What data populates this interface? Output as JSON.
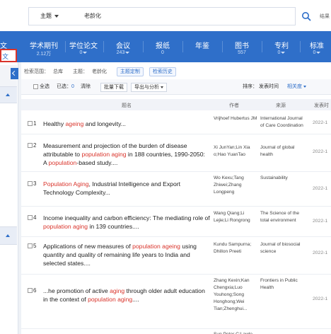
{
  "topbar": {
    "subject_label": "主题",
    "search_value": "老龄化",
    "right_text": "结果"
  },
  "nav": {
    "left_partial": "文",
    "items": [
      {
        "label": "学术期刊",
        "count": "2.12万"
      },
      {
        "label": "学位论文",
        "count": "0"
      },
      {
        "label": "会议",
        "count": "243"
      },
      {
        "label": "报纸",
        "count": "0"
      },
      {
        "label": "年鉴",
        "count": ""
      },
      {
        "label": "图书",
        "count": "557"
      },
      {
        "label": "专利",
        "count": "0"
      },
      {
        "label": "标准",
        "count": "0"
      }
    ]
  },
  "left_panel": {
    "selected_label": "文"
  },
  "filters": {
    "scope_label": "检索范围：",
    "scope_value": "总库",
    "subject_label": "主题：",
    "subject_value": "老龄化",
    "tag1": "主题定制",
    "tag2": "检索历史"
  },
  "toolbar": {
    "select_all": "全选",
    "selected": "已选：",
    "selected_count": "0",
    "clear": "清除",
    "batch_download": "批量下载",
    "export": "导出与分析",
    "sort_label": "排序：",
    "sort_date": "发表时间",
    "sort_relevance": "相关度"
  },
  "table": {
    "headers": {
      "title": "题名",
      "author": "作者",
      "source": "来源",
      "date": "发表时"
    },
    "rows": [
      {
        "num": "1",
        "title": [
          {
            "t": "Healthy "
          },
          {
            "t": "ageing",
            "hl": true
          },
          {
            "t": " and longevity..."
          }
        ],
        "author": "Vrijhoef Hubertus JM",
        "source": "International Journal of Care Coordination",
        "date": "2022-1"
      },
      {
        "num": "2",
        "title": [
          {
            "t": "Measurement and projection of the burden of disease attributable to "
          },
          {
            "t": "population aging",
            "hl": true
          },
          {
            "t": " in 188 countries, 1990-2050: A "
          },
          {
            "t": "population",
            "hl": true
          },
          {
            "t": "-based study...."
          }
        ],
        "author": "Xi JunYan;Lin Xia o;Hao YuanTao",
        "source": "Journal of global health",
        "date": "2022-1"
      },
      {
        "num": "3",
        "title": [
          {
            "t": "Population Aging",
            "hl": true
          },
          {
            "t": ", Industrial Intelligence and Export Technology Complexity..."
          }
        ],
        "author": "Wo Kexu;Tang Zhiwei;Zhang Longpeng",
        "source": "Sustainability",
        "date": "2022-1"
      },
      {
        "num": "4",
        "title": [
          {
            "t": "Income inequality and carbon efficiency: The mediating role of "
          },
          {
            "t": "population aging",
            "hl": true
          },
          {
            "t": " in 139 countries...."
          }
        ],
        "author": "Wang Qiang;Li Lejie;Li Rongrong",
        "source": "The Science of the total environment",
        "date": "2022-1"
      },
      {
        "num": "5",
        "title": [
          {
            "t": "Applications of new measures of "
          },
          {
            "t": "population ageing",
            "hl": true
          },
          {
            "t": " using quantity and quality of remaining life years to India and selected states...."
          }
        ],
        "author": "Kundu Sampurna; Dhillon Preeti",
        "source": "Journal of biosocial science",
        "date": "2022-1"
      },
      {
        "num": "6",
        "title": [
          {
            "t": "...he promotion of active "
          },
          {
            "t": "aging",
            "hl": true
          },
          {
            "t": " through older adult education in the context of "
          },
          {
            "t": "population aging",
            "hl": true
          },
          {
            "t": "...."
          }
        ],
        "author": "Zhang Kexin;Kan Chengxia;Luo Youhong;Song Honghong;Wei Tian;Zhenghui...",
        "source": "Frontiers in Public Health",
        "date": "2022-1"
      },
      {
        "num": "7",
        "title": [
          {
            "t": ""
          }
        ],
        "author": "Sun Peter C;Lawlo",
        "source": "",
        "date": ""
      }
    ]
  },
  "colors": {
    "primary": "#2f6fc9",
    "highlight": "#d9342b",
    "selected_border": "#d9342b"
  },
  "icons": {
    "search": "magnifier-icon",
    "collapse": "chevron-left-icon"
  }
}
